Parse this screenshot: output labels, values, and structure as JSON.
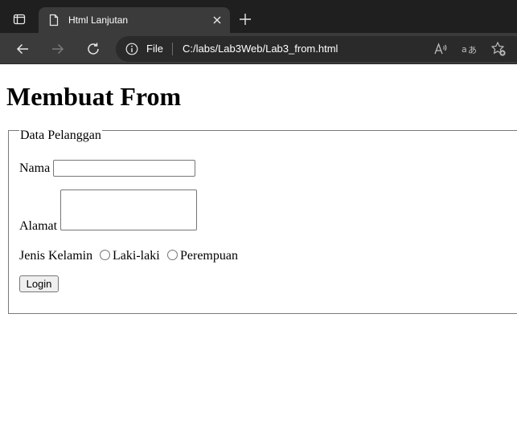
{
  "browser": {
    "tab_title": "Html Lanjutan",
    "address_scheme": "File",
    "address_url": "C:/labs/Lab3Web/Lab3_from.html"
  },
  "page": {
    "heading": "Membuat From",
    "form": {
      "legend": "Data Pelanggan",
      "nama_label": "Nama",
      "nama_value": "",
      "alamat_label": "Alamat",
      "alamat_value": "",
      "gender_label": "Jenis Kelamin",
      "gender_options": [
        "Laki-laki",
        "Perempuan"
      ],
      "submit_label": "Login"
    }
  },
  "icons": {
    "tab_actions": "tab-actions-icon",
    "page_favicon": "document-icon",
    "close_tab": "close-icon",
    "new_tab": "plus-icon",
    "back": "arrow-left-icon",
    "forward": "arrow-right-icon",
    "reload": "reload-icon",
    "site_info": "info-icon",
    "read_aloud": "read-aloud-icon",
    "translate": "translate-icon",
    "favorites": "add-favorite-icon"
  },
  "colors": {
    "tabbar_bg": "#1f1f1f",
    "toolbar_bg": "#3b3b3b",
    "icon_fg": "#e8e8e8",
    "disabled_fg": "#7a7a7a"
  }
}
